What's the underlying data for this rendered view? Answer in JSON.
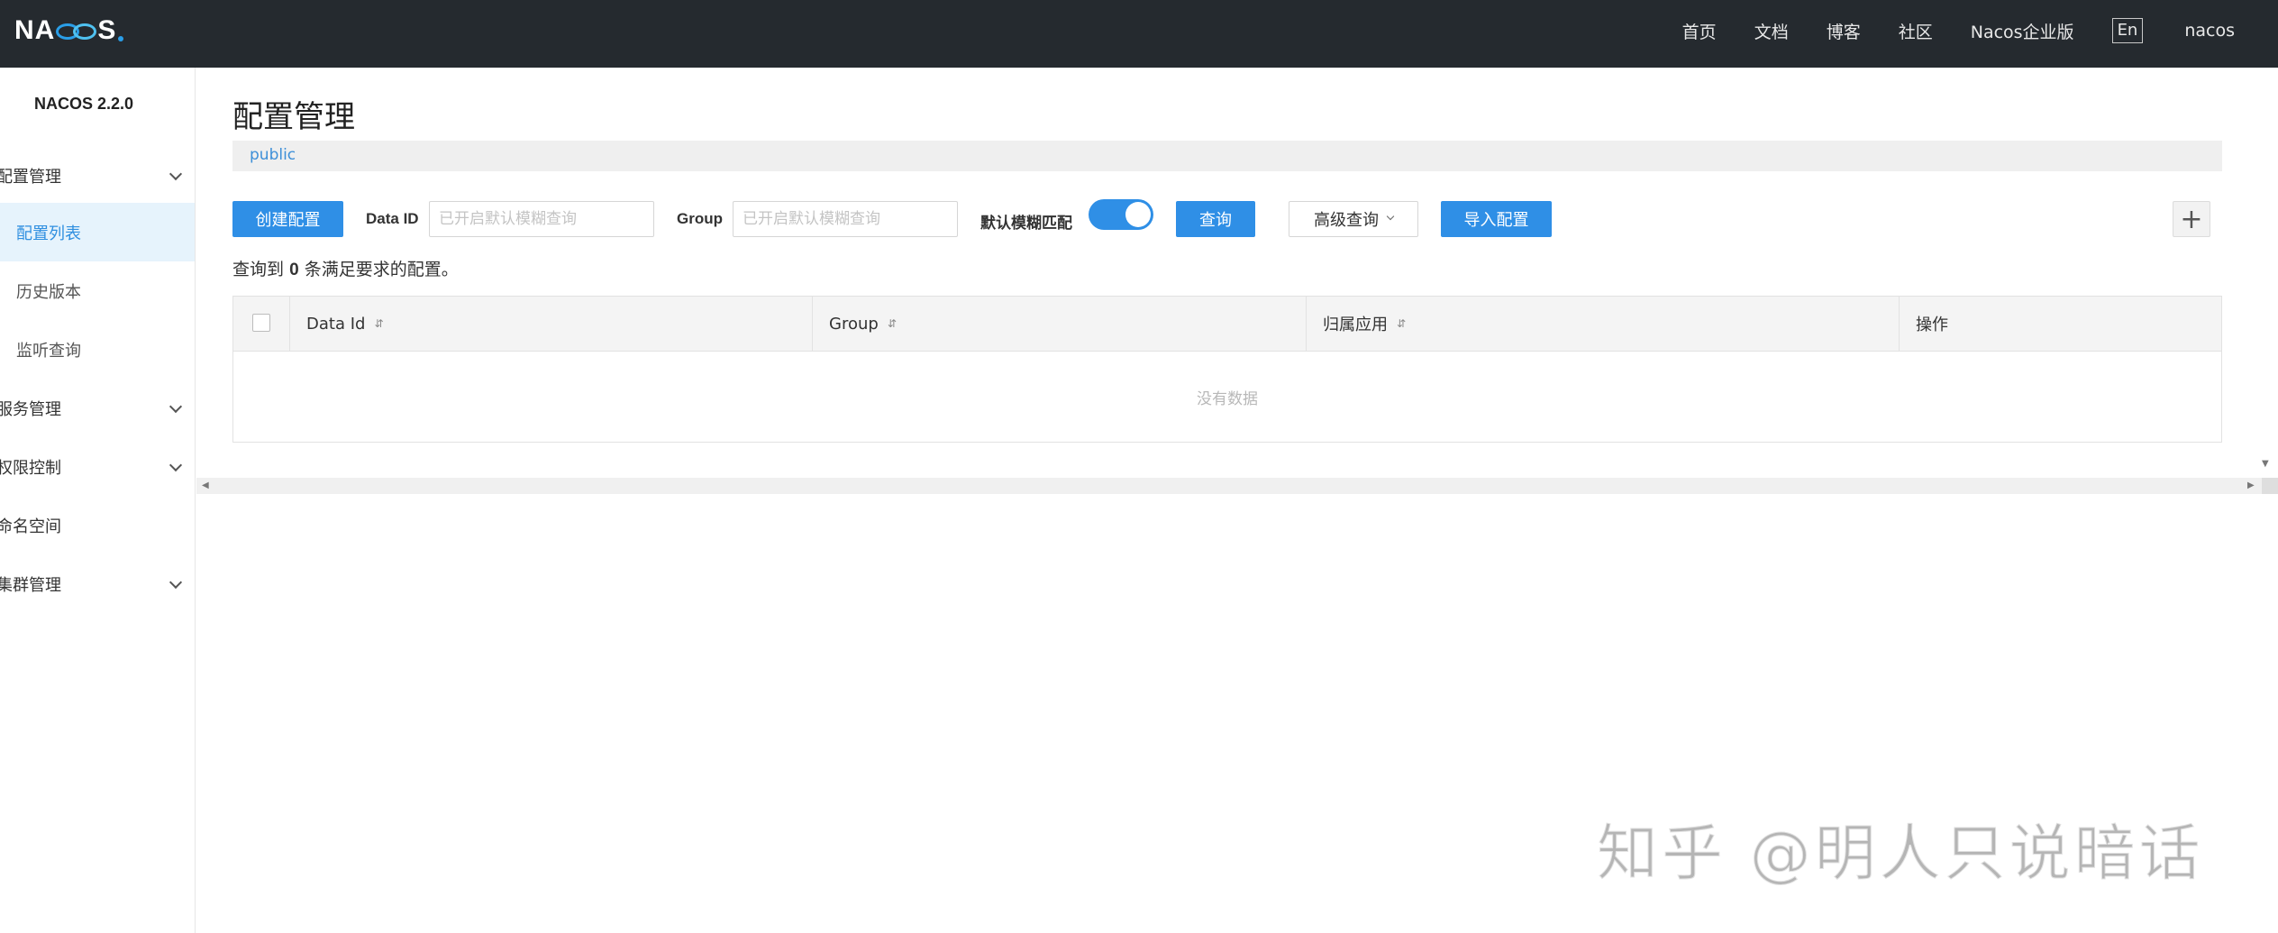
{
  "header": {
    "brand": "NACOS",
    "nav": [
      "首页",
      "文档",
      "博客",
      "社区",
      "Nacos企业版"
    ],
    "lang": "En",
    "user": "nacos"
  },
  "sidebar": {
    "version": "NACOS 2.2.0",
    "items": [
      {
        "label": "配置管理",
        "expandable": true
      },
      {
        "label": "配置列表",
        "active": true
      },
      {
        "label": "历史版本"
      },
      {
        "label": "监听查询"
      },
      {
        "label": "服务管理",
        "expandable": true
      },
      {
        "label": "权限控制",
        "expandable": true
      },
      {
        "label": "命名空间"
      },
      {
        "label": "集群管理",
        "expandable": true
      }
    ]
  },
  "main": {
    "title": "配置管理",
    "namespace": "public",
    "create_button": "创建配置",
    "dataid_label": "Data ID",
    "dataid_placeholder": "已开启默认模糊查询",
    "group_label": "Group",
    "group_placeholder": "已开启默认模糊查询",
    "fuzzy_label": "默认模糊匹配",
    "fuzzy_enabled": true,
    "query_button": "查询",
    "advanced_button": "高级查询",
    "import_button": "导入配置",
    "result_prefix": "查询到",
    "result_count": "0",
    "result_suffix": "条满足要求的配置。",
    "table": {
      "columns": [
        "Data Id",
        "Group",
        "归属应用",
        "操作"
      ],
      "empty_text": "没有数据"
    }
  },
  "watermark": "知乎 @明人只说暗话",
  "colors": {
    "topbar": "#252a2f",
    "primary": "#2f8fe6",
    "active_bg": "#e6f3fc"
  }
}
